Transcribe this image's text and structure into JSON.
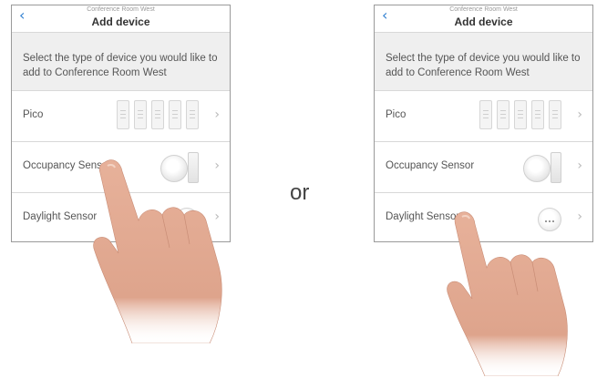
{
  "screens": [
    {
      "nav": {
        "subtitle": "Conference Room West",
        "title": "Add device",
        "back_icon": "chevron-left-icon"
      },
      "instruction": "Select the type of device you would like to add to Conference Room West",
      "rows": [
        {
          "label": "Pico"
        },
        {
          "label": "Occupancy Sensor"
        },
        {
          "label": "Daylight Sensor"
        }
      ]
    },
    {
      "nav": {
        "subtitle": "Conference Room West",
        "title": "Add device",
        "back_icon": "chevron-left-icon"
      },
      "instruction": "Select the type of device you would like to add to Conference Room West",
      "rows": [
        {
          "label": "Pico"
        },
        {
          "label": "Occupancy Sensor"
        },
        {
          "label": "Daylight Sensor"
        }
      ]
    }
  ],
  "separator": "or",
  "colors": {
    "accent": "#2f7fd0",
    "instruction_bg": "#efefef",
    "skin": "#e0a58d"
  }
}
